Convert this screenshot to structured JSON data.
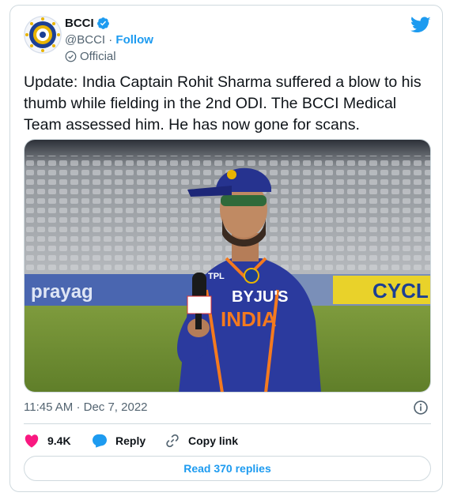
{
  "author": {
    "name": "BCCI",
    "handle": "@BCCI",
    "separator": "·",
    "follow_label": "Follow",
    "official_label": "Official"
  },
  "tweet": {
    "text": "Update: India Captain Rohit Sharma suffered a blow to his thumb while fielding in the 2nd ODI. The BCCI Medical Team assessed him. He has now gone for scans.",
    "time": "11:45 AM",
    "date": "Dec 7, 2022",
    "meta_separator": "·"
  },
  "media": {
    "jersey_sponsor": "BYJU'S",
    "jersey_team": "INDIA",
    "jersey_small": "TPL",
    "board_left": "prayag",
    "board_right": "CYCL"
  },
  "actions": {
    "likes": "9.4K",
    "reply_label": "Reply",
    "copy_label": "Copy link"
  },
  "read_replies_label": "Read 370 replies",
  "colors": {
    "accent": "#1d9bf0",
    "like": "#f91880",
    "muted": "#536471",
    "border": "#cfd9de"
  },
  "icons": [
    "bcci-logo-avatar",
    "verified-badge-icon",
    "official-check-icon",
    "twitter-bird-icon",
    "info-icon",
    "heart-icon",
    "reply-bubble-icon",
    "link-icon"
  ]
}
